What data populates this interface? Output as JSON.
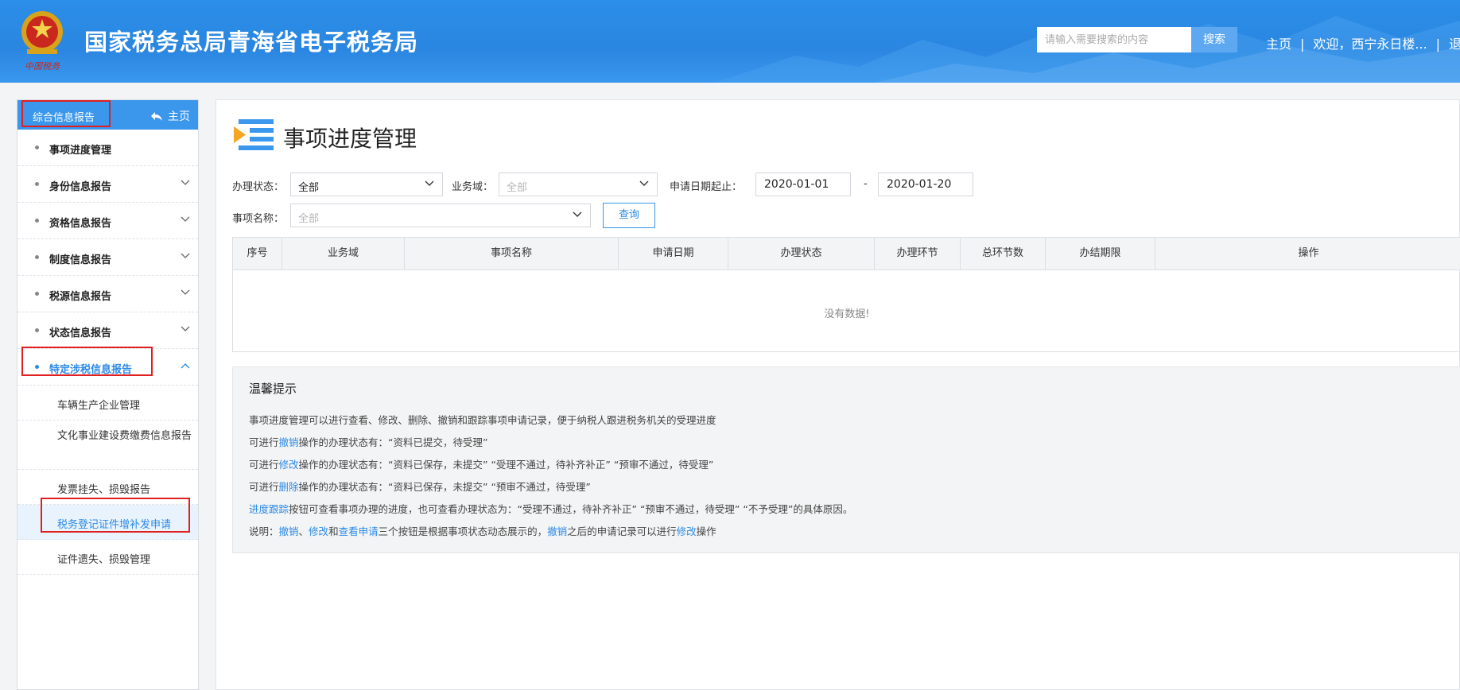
{
  "header": {
    "emblem_text": "中国税务",
    "title": "国家税务总局青海省电子税务局",
    "search_placeholder": "请输入需要搜索的内容",
    "search_button": "搜索",
    "nav": {
      "home": "主页",
      "welcome": "欢迎，西宁永日楼...",
      "logout": "退"
    }
  },
  "sidebar": {
    "title": "综合信息报告",
    "home": "主页",
    "items": [
      {
        "label": "事项进度管理"
      },
      {
        "label": "身份信息报告"
      },
      {
        "label": "资格信息报告"
      },
      {
        "label": "制度信息报告"
      },
      {
        "label": "税源信息报告"
      },
      {
        "label": "状态信息报告"
      },
      {
        "label": "特定涉税信息报告"
      }
    ],
    "subitems": [
      {
        "label": "车辆生产企业管理"
      },
      {
        "label": "文化事业建设费缴费信息报告"
      },
      {
        "label": "发票挂失、损毁报告"
      },
      {
        "label": "税务登记证件增补发申请"
      },
      {
        "label": "证件遗失、损毁管理"
      }
    ]
  },
  "main": {
    "title": "事项进度管理",
    "filters": {
      "status_label": "办理状态：",
      "status_value": "全部",
      "domain_label": "业务域：",
      "domain_placeholder": "全部",
      "date_label": "申请日期起止：",
      "date_from": "2020-01-01",
      "date_sep": "-",
      "date_to": "2020-01-20",
      "name_label": "事项名称：",
      "name_placeholder": "全部",
      "query_button": "查询"
    },
    "table": {
      "columns": [
        "序号",
        "业务域",
        "事项名称",
        "申请日期",
        "办理状态",
        "办理环节",
        "总环节数",
        "办结期限",
        "操作"
      ],
      "empty_text": "没有数据!"
    },
    "tips": {
      "title": "温馨提示",
      "line1": "事项进度管理可以进行查看、修改、删除、撤销和跟踪事项申请记录，便于纳税人跟进税务机关的受理进度",
      "line2_pre": "可进行",
      "line2_link": "撤销",
      "line2_post": "操作的办理状态有：“资料已提交，待受理”",
      "line3_pre": "可进行",
      "line3_link": "修改",
      "line3_post": "操作的办理状态有：“资料已保存，未提交”  “受理不通过，待补齐补正”  “预审不通过，待受理”",
      "line4_pre": "可进行",
      "line4_link": "删除",
      "line4_post": "操作的办理状态有：“资料已保存，未提交”  “预审不通过，待受理”",
      "line5_link": "进度跟踪",
      "line5_post": "按钮可查看事项办理的进度，也可查看办理状态为：“受理不通过，待补齐补正”  “预审不通过，待受理”  “不予受理”的具体原因。",
      "line6_pre": "说明：",
      "line6_link1": "撤销",
      "line6_sep1": "、",
      "line6_link2": "修改",
      "line6_and": "和",
      "line6_link3": "查看申请",
      "line6_mid": "三个按钮是根据事项状态动态展示的，",
      "line6_link4": "撤销",
      "line6_mid2": "之后的申请记录可以进行",
      "line6_link5": "修改",
      "line6_post": "操作"
    }
  },
  "colors": {
    "header_blue": "#2b8ee8",
    "accent": "#2c8ae6",
    "highlight_box": "#e02020"
  }
}
